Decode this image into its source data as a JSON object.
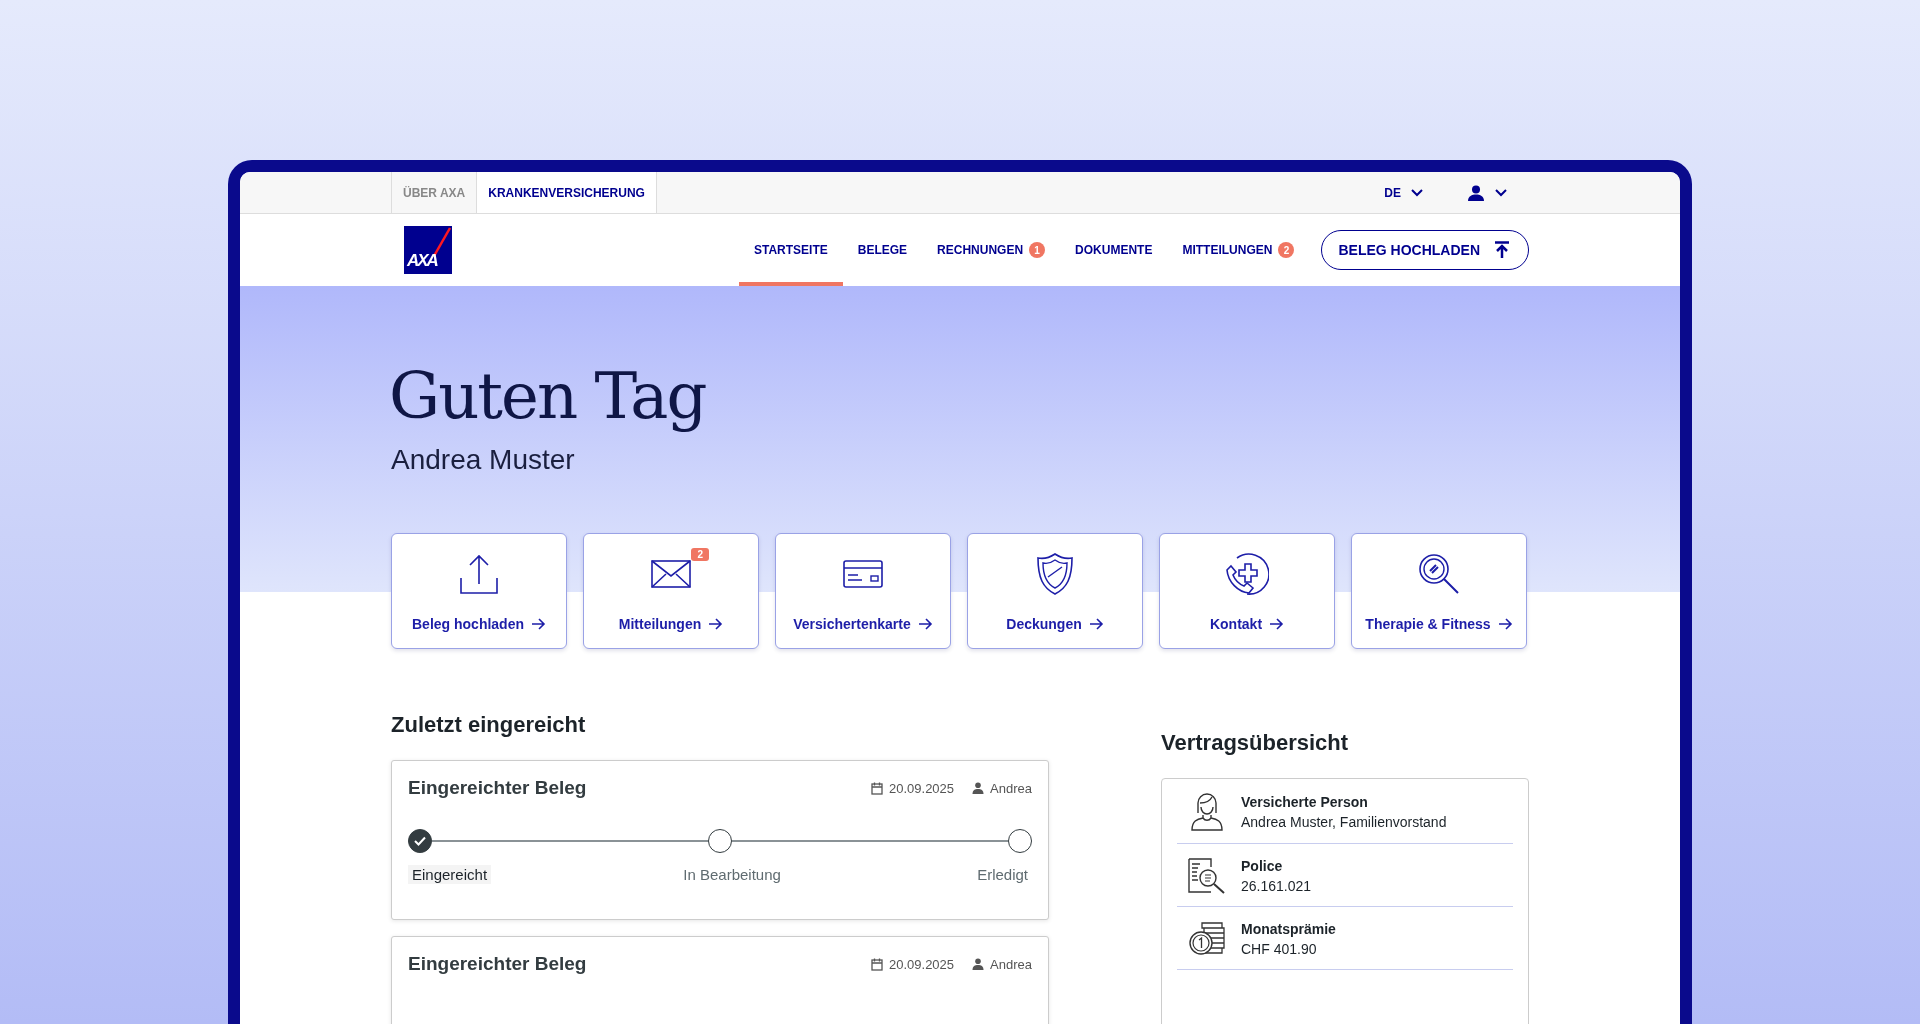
{
  "utility_bar": {
    "tabs": [
      {
        "label": "ÜBER AXA",
        "selected": false
      },
      {
        "label": "KRANKENVERSICHERUNG",
        "selected": true
      }
    ],
    "language": "DE"
  },
  "logo": {
    "text": "AXA"
  },
  "nav": {
    "items": [
      {
        "label": "STARTSEITE",
        "selected": true
      },
      {
        "label": "BELEGE",
        "selected": false
      },
      {
        "label": "RECHNUNGEN",
        "badge": "1",
        "selected": false
      },
      {
        "label": "DOKUMENTE",
        "selected": false
      },
      {
        "label": "MITTEILUNGEN",
        "badge": "2",
        "selected": false
      }
    ],
    "upload_button": "BELEG HOCHLADEN"
  },
  "hero": {
    "greeting": "Guten Tag",
    "name": "Andrea Muster"
  },
  "tiles": [
    {
      "kind": "upload",
      "label": "Beleg hochladen"
    },
    {
      "kind": "mail",
      "label": "Mitteilungen",
      "badge": "2"
    },
    {
      "kind": "card",
      "label": "Versichertenkarte"
    },
    {
      "kind": "shield",
      "label": "Deckungen"
    },
    {
      "kind": "contact",
      "label": "Kontakt"
    },
    {
      "kind": "search",
      "label": "Therapie & Fitness"
    }
  ],
  "recent": {
    "title": "Zuletzt eingereicht",
    "cards": [
      {
        "title": "Eingereichter Beleg",
        "date": "20.09.2025",
        "person": "Andrea",
        "steps": [
          {
            "label": "Eingereicht",
            "done": true
          },
          {
            "label": "In Bearbeitung",
            "done": false
          },
          {
            "label": "Erledigt",
            "done": false
          }
        ]
      },
      {
        "title": "Eingereichter Beleg",
        "date": "20.09.2025",
        "person": "Andrea"
      }
    ]
  },
  "contract": {
    "title": "Vertragsübersicht",
    "items": [
      {
        "kind": "person",
        "label": "Versicherte Person",
        "value": "Andrea Muster, Familienvorstand"
      },
      {
        "kind": "policy",
        "label": "Police",
        "value": "26.161.021"
      },
      {
        "kind": "premium",
        "label": "Monatsprämie",
        "value": "CHF 401.90"
      }
    ]
  }
}
